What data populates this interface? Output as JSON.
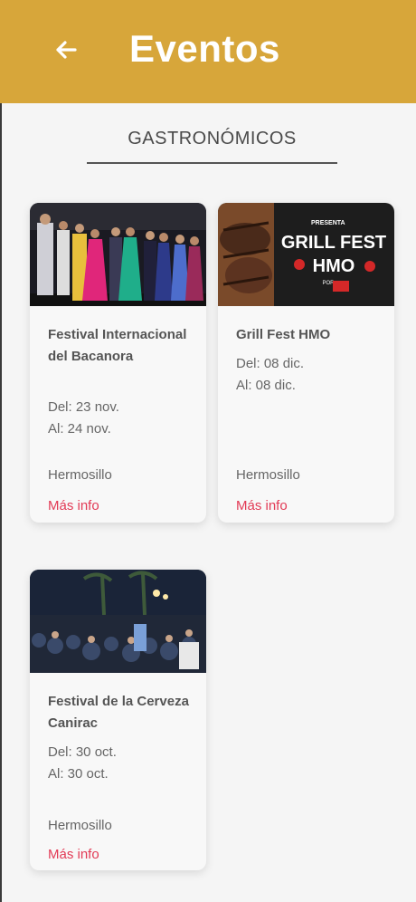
{
  "header": {
    "title": "Eventos",
    "back_icon": "arrow-left-icon",
    "color": "#d7a63a"
  },
  "section": {
    "title": "GASTRONÓMICOS"
  },
  "events": [
    {
      "name": "Festival Internacional del Bacanora",
      "from": "Del: 23 nov.",
      "to": "Al: 24 nov.",
      "city": "Hermosillo",
      "link": "Más info"
    },
    {
      "name": "Grill Fest HMO",
      "from": "Del: 08 dic.",
      "to": "Al: 08 dic.",
      "city": "Hermosillo",
      "link": "Más info",
      "poster": {
        "presenter": "PRESENTA",
        "line1": "GRILL FEST",
        "line2": "HMO",
        "sponsor": "POR"
      }
    },
    {
      "name": "Festival de la Cerveza Canirac",
      "from": "Del: 30 oct.",
      "to": "Al: 30 oct.",
      "city": "Hermosillo",
      "link": "Más info"
    }
  ],
  "link_color": "#e23a55"
}
